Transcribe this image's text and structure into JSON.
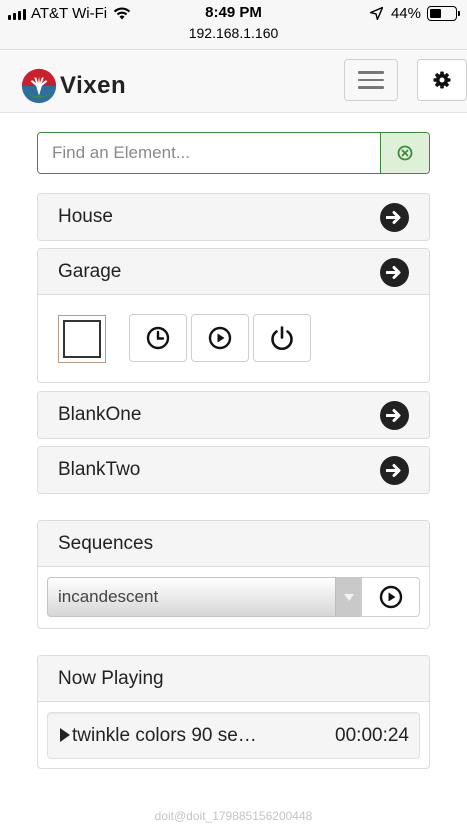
{
  "status_bar": {
    "carrier": "AT&T Wi-Fi",
    "time": "8:49 PM",
    "url": "192.168.1.160",
    "battery_percent_label": "44%",
    "battery_level": 0.44,
    "signal_bars": 4,
    "icons": [
      "signal-bars-icon",
      "wifi-icon",
      "location-arrow-icon",
      "battery-icon"
    ]
  },
  "navbar": {
    "brand_name": "Vixen",
    "icons": [
      "vixen-logo",
      "hamburger-menu-icon",
      "gear-icon"
    ]
  },
  "search": {
    "placeholder": "Find an Element...",
    "value": "",
    "clear_icon": "close-circle-icon",
    "accent_color": "#3c8a3c"
  },
  "elements": {
    "house_label": "House",
    "garage_label": "Garage",
    "blank_one_label": "BlankOne",
    "blank_two_label": "BlankTwo",
    "expand_icon": "arrow-right-circle-icon",
    "garage_controls": [
      "checkbox",
      "clock-icon",
      "play-circle-icon",
      "power-icon"
    ]
  },
  "sequences": {
    "title": "Sequences",
    "selected": "incandescent",
    "play_icon": "play-circle-icon"
  },
  "now_playing": {
    "title": "Now Playing",
    "track": "twinkle colors 90 se…",
    "elapsed": "00:00:24"
  },
  "watermark": "doit@doit_179885156200448"
}
